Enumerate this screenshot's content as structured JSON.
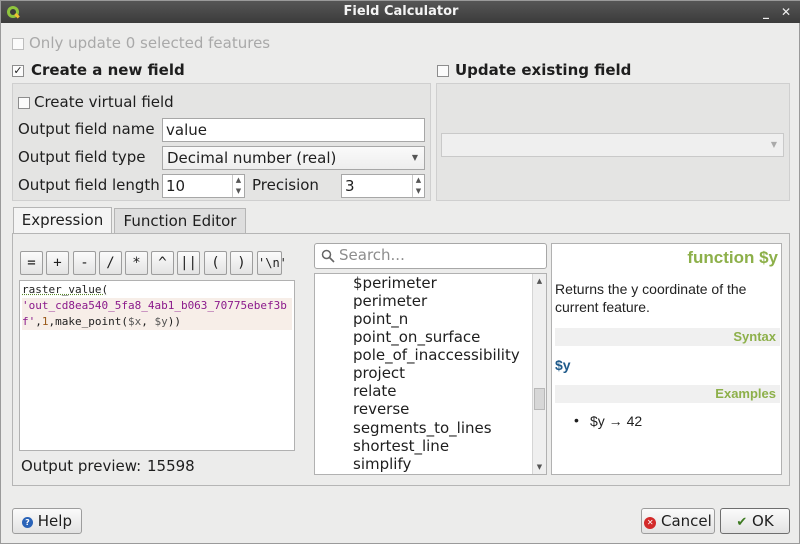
{
  "window": {
    "title": "Field Calculator"
  },
  "only_update": {
    "label": "Only update 0 selected features",
    "checked": false,
    "enabled": false
  },
  "create_new_field": {
    "label": "Create a new field",
    "checked": true
  },
  "update_existing": {
    "label": "Update existing field",
    "checked": false
  },
  "virtual_field": {
    "label": "Create virtual field",
    "checked": false
  },
  "output_name": {
    "label": "Output field name",
    "value": "value"
  },
  "output_type": {
    "label": "Output field type",
    "value": "Decimal number (real)"
  },
  "output_length": {
    "label": "Output field length",
    "value": "10"
  },
  "precision": {
    "label": "Precision",
    "value": "3"
  },
  "tabs": [
    {
      "label": "Expression",
      "active": true
    },
    {
      "label": "Function Editor",
      "active": false
    }
  ],
  "operators": [
    "=",
    "+",
    "-",
    "/",
    "*",
    "^",
    "||",
    "(",
    ")",
    "'\\n'"
  ],
  "expression": {
    "line1": "raster_value(",
    "line2": "'out_cd8ea540_5fa8_4ab1_b063_70775ebef3b",
    "line3_str": "f'",
    "line3_a": ",",
    "line3_num": "1",
    "line3_b": ",make_point(",
    "line3_var1": "$x",
    "line3_c": ", ",
    "line3_var2": "$y",
    "line3_d": "))"
  },
  "output_preview": {
    "label": "Output preview:",
    "value": "15598"
  },
  "search": {
    "placeholder": "Search..."
  },
  "function_list": [
    "$perimeter",
    "perimeter",
    "point_n",
    "point_on_surface",
    "pole_of_inaccessibility",
    "project",
    "relate",
    "reverse",
    "segments_to_lines",
    "shortest_line",
    "simplify"
  ],
  "help": {
    "title": "function $y",
    "description": "Returns the y coordinate of the current feature.",
    "syntax_header": "Syntax",
    "syntax": "$y",
    "examples_header": "Examples",
    "example": "$y → 42"
  },
  "buttons": {
    "help": "Help",
    "cancel": "Cancel",
    "ok": "OK"
  },
  "colors": {
    "accent_green": "#8db04a",
    "titlebar": "#3b3b3b",
    "syntax_blue": "#1f5a8a"
  }
}
